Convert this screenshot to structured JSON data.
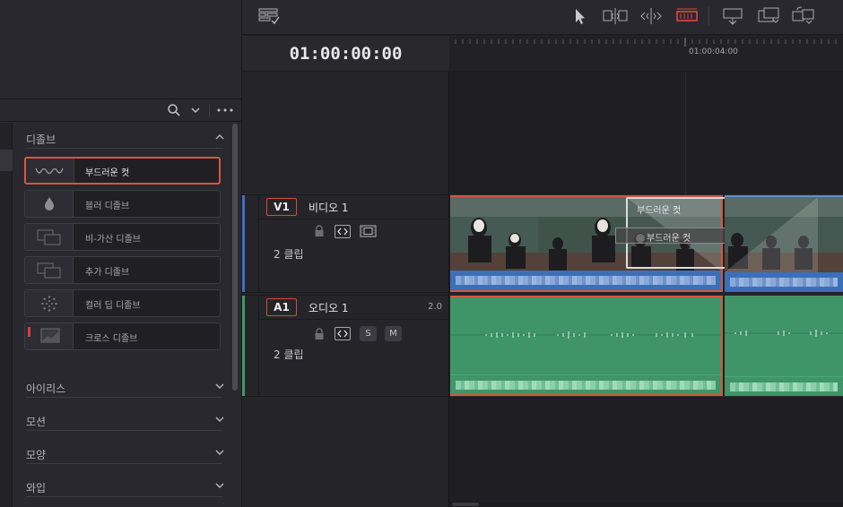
{
  "timecode": "01:00:00:00",
  "ruler": {
    "time_label": "01:00:04:00"
  },
  "effects_panel": {
    "sections": {
      "dissolve": "디졸브",
      "iris": "아이리스",
      "motion": "모션",
      "shape": "모양",
      "wipe": "와입"
    },
    "items": [
      {
        "label": "부드러운 컷",
        "icon": "wave-icon",
        "selected": true
      },
      {
        "label": "블러 디졸브",
        "icon": "drop-icon",
        "selected": false
      },
      {
        "label": "비-가산 디졸브",
        "icon": "overlap-icon",
        "selected": false
      },
      {
        "label": "추가 디졸브",
        "icon": "overlap-icon",
        "selected": false
      },
      {
        "label": "컬러 딥 디졸브",
        "icon": "dots-icon",
        "selected": false
      },
      {
        "label": "크로스 디졸브",
        "icon": "overlap-icon",
        "selected": false
      }
    ]
  },
  "tracks": {
    "video": {
      "id": "V1",
      "name": "비디오 1",
      "clips": "2 클립"
    },
    "audio": {
      "id": "A1",
      "name": "오디오 1",
      "clips": "2 클립",
      "level": "2.0",
      "solo": "S",
      "mute": "M"
    }
  },
  "transition": {
    "label": "부드러운 컷",
    "label_repeat": "부드러운 컷"
  },
  "colors": {
    "video_accent": "#3f6fc2",
    "audio_accent": "#3b9a66",
    "selection_red": "#d6553e",
    "audio_clip": "#3f9567"
  }
}
